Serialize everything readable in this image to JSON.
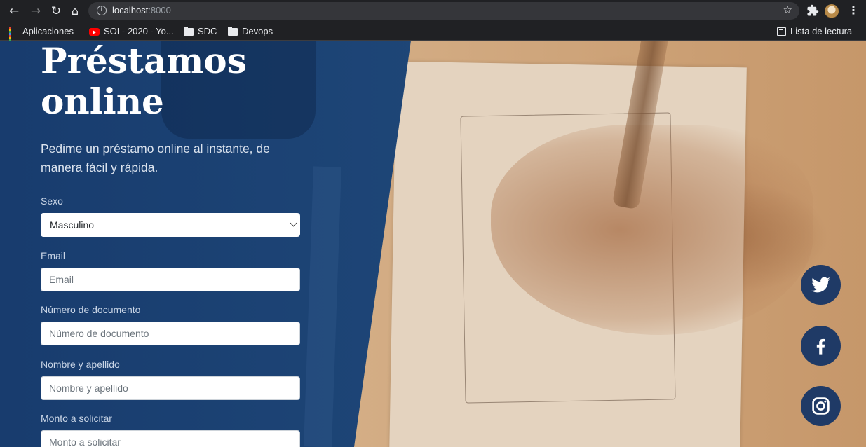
{
  "browser": {
    "url_host": "localhost",
    "url_port": ":8000",
    "reading_list": "Lista de lectura",
    "bookmarks": [
      {
        "label": "Aplicaciones",
        "icon": "apps-grid-icon"
      },
      {
        "label": "SOI - 2020 - Yo...",
        "icon": "youtube-icon"
      },
      {
        "label": "SDC",
        "icon": "folder-icon"
      },
      {
        "label": "Devops",
        "icon": "folder-icon"
      }
    ]
  },
  "hero": {
    "title_line1": "Préstamos",
    "title_line2": "online",
    "subtitle": "Pedime un préstamo online al instante, de manera fácil y rápida."
  },
  "form": {
    "sexo": {
      "label": "Sexo",
      "value": "Masculino"
    },
    "email": {
      "label": "Email",
      "placeholder": "Email"
    },
    "documento": {
      "label": "Número de documento",
      "placeholder": "Número de documento"
    },
    "nombre": {
      "label": "Nombre y apellido",
      "placeholder": "Nombre y apellido"
    },
    "monto": {
      "label": "Monto a solicitar",
      "placeholder": "Monto a solicitar"
    }
  },
  "social": [
    "twitter-icon",
    "facebook-icon",
    "instagram-icon"
  ],
  "colors": {
    "overlay": "#1f4879",
    "social_bg": "#1f3a66",
    "chrome_bg": "#202124"
  }
}
